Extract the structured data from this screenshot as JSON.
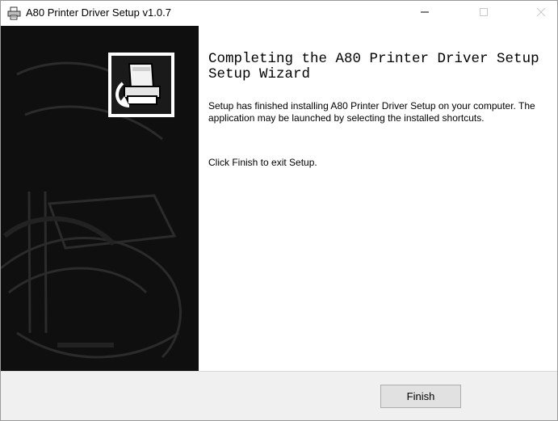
{
  "window": {
    "title": "A80 Printer Driver Setup v1.0.7",
    "controls": {
      "minimize": "—"
    }
  },
  "wizard": {
    "heading": "Completing the A80 Printer Driver Setup Setup Wizard",
    "body": "Setup has finished installing A80 Printer Driver Setup on your computer. The application may be launched by selecting the installed shortcuts.",
    "exit_hint": "Click Finish to exit Setup."
  },
  "buttons": {
    "finish": "Finish"
  },
  "icons": {
    "app": "installer-printer-icon",
    "badge": "printer-install-icon",
    "minimize": "minimize-icon",
    "maximize": "maximize-icon",
    "close": "close-icon"
  },
  "colors": {
    "sidebar": "#0f0f0f",
    "footer": "#f0f0f0",
    "button_face": "#e1e1e1",
    "button_border": "#adadad"
  }
}
